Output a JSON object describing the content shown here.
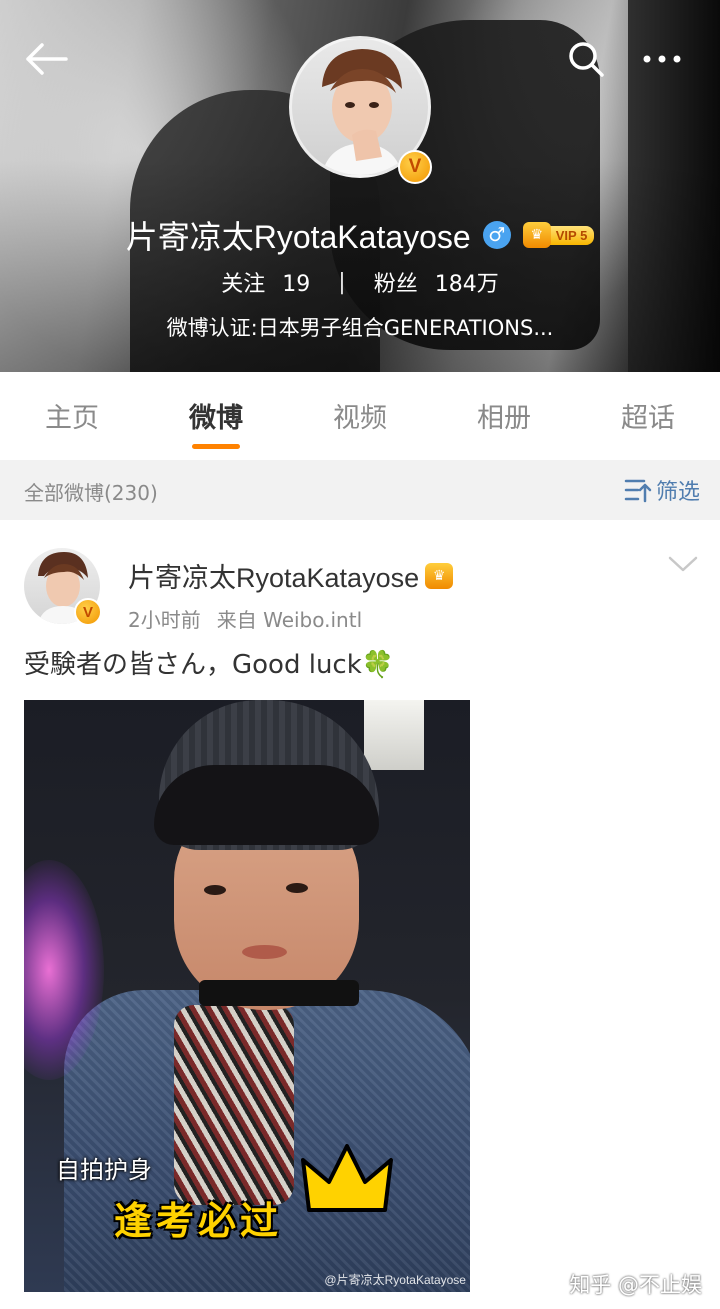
{
  "header": {
    "username": "片寄凉太RyotaKatayose",
    "gender_symbol": "♂",
    "vip_label": "VIP 5",
    "verified_badge": "V",
    "stats": {
      "following_label": "关注",
      "following_count": "19",
      "separator": "|",
      "followers_label": "粉丝",
      "followers_count": "184万"
    },
    "verification": "微博认证:日本男子组合GENERATIONS..."
  },
  "tabs": [
    {
      "label": "主页",
      "active": false
    },
    {
      "label": "微博",
      "active": true
    },
    {
      "label": "视频",
      "active": false
    },
    {
      "label": "相册",
      "active": false
    },
    {
      "label": "超话",
      "active": false
    }
  ],
  "filter": {
    "label": "全部微博(230)",
    "button_label": "筛选"
  },
  "post": {
    "author": "片寄凉太RyotaKatayose",
    "verified_badge": "V",
    "time": "2小时前",
    "source": "来自 Weibo.intl",
    "text": "受験者の皆さん，Good luck",
    "emoji": "🍀",
    "image": {
      "sticker_small": "自拍护身",
      "sticker_large": "逢考必过",
      "watermark": "@片寄凉太RyotaKatayose"
    }
  },
  "overlay_watermark": "知乎 @不止娱",
  "colors": {
    "accent_orange": "#ff8200",
    "link_blue": "#507daf",
    "gray_text": "#8a8a8a",
    "vip_gold": "#f7b500",
    "gender_blue": "#4aa3f0"
  },
  "icons": [
    "back-arrow-icon",
    "search-icon",
    "more-icon",
    "filter-icon",
    "chevron-down-icon",
    "crown-icon"
  ]
}
